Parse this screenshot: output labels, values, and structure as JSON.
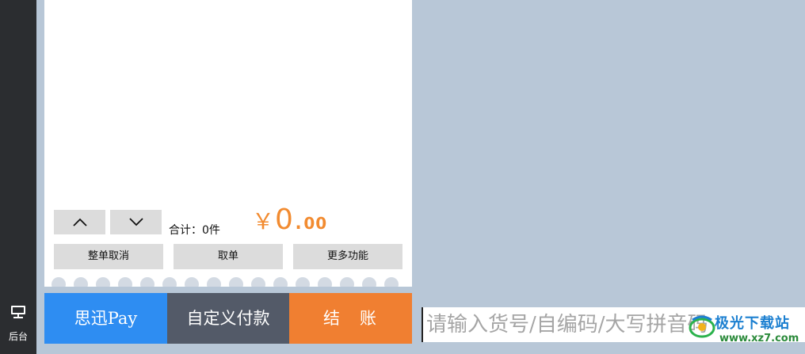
{
  "sidebar": {
    "back_label": "后台",
    "back_icon": "monitor-icon"
  },
  "cart": {
    "up_icon": "chevron-up-icon",
    "down_icon": "chevron-down-icon",
    "total_label": "合计：0件",
    "currency": "￥",
    "amount_main": "0.",
    "amount_cents": "00"
  },
  "actions": {
    "clear_order": "整单取消",
    "retrieve_order": "取单",
    "more_functions": "更多功能"
  },
  "payment": {
    "xunpay": "思迅Pay",
    "custom_pay": "自定义付款",
    "checkout": "结　账"
  },
  "search": {
    "placeholder": "请输入货号/自编码/大写拼音码"
  },
  "watermark": {
    "name": "极光下载站",
    "url": "www.xz7.com"
  },
  "colors": {
    "accent_orange": "#f07f31",
    "pay_blue": "#2e8df2",
    "pay_gray": "#535a68",
    "amount_orange": "#f28b30"
  }
}
